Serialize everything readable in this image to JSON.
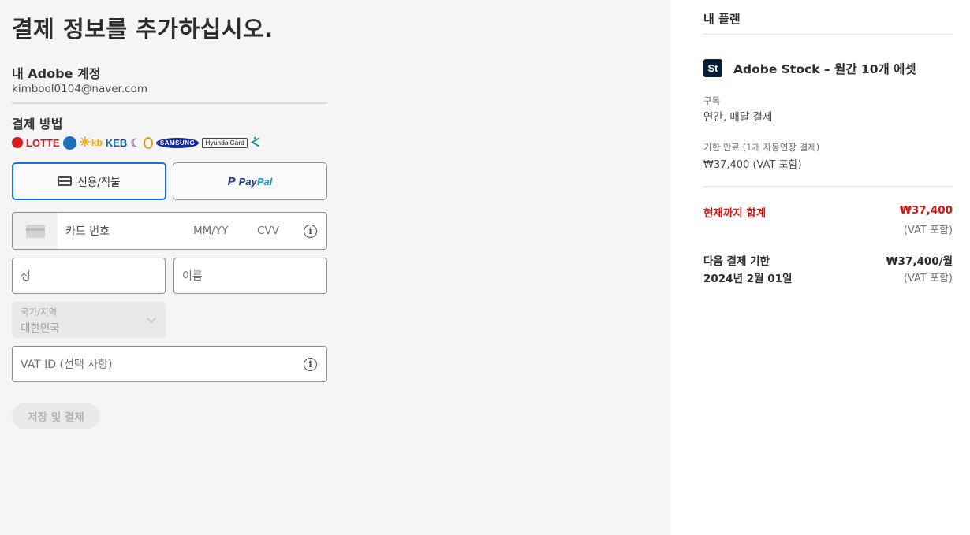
{
  "checkout": {
    "title": "결제 정보를 추가하십시오.",
    "account_label": "내 Adobe 계정",
    "account_email": "kimbool0104@naver.com",
    "payment_method_label": "결제 방법",
    "card_logos": {
      "lotte": "LOTTE",
      "keb": "KEB",
      "kb": "kb",
      "samsung": "SAMSUNG",
      "hyundai": "HyundaiCard"
    },
    "method_tabs": {
      "card_label": "신용/직불",
      "paypal_part1": "Pay",
      "paypal_part2": "Pal"
    },
    "card_form": {
      "card_number_placeholder": "카드 번호",
      "expiry_placeholder": "MM/YY",
      "cvv_placeholder": "CVV"
    },
    "last_name_placeholder": "성",
    "first_name_placeholder": "이름",
    "country": {
      "caption": "국가/지역",
      "value": "대한민국"
    },
    "vat_placeholder": "VAT ID (선택 사항)",
    "save_button": "저장 및 결제"
  },
  "plan": {
    "title": "내 플랜",
    "product_badge": "St",
    "product_name": "Adobe Stock – 월간 10개 에셋",
    "subscription_caption": "구독",
    "subscription_value": "연간, 매달 결제",
    "expiry_caption": "기한 만료 (1개 자동연장 결제)",
    "expiry_value": "₩37,400 (VAT 포함)",
    "total_label": "현재까지 합계",
    "total_amount": "₩37,400",
    "total_vat": "(VAT 포함)",
    "next_label": "다음 결제 기한",
    "next_date": "2024년 2월 01일",
    "next_amount": "₩37,400/월",
    "next_vat": "(VAT 포함)"
  },
  "colors": {
    "accent_blue": "#1473e6",
    "total_red": "#d31510",
    "paypal_dark": "#253b80",
    "paypal_light": "#179bd7"
  }
}
